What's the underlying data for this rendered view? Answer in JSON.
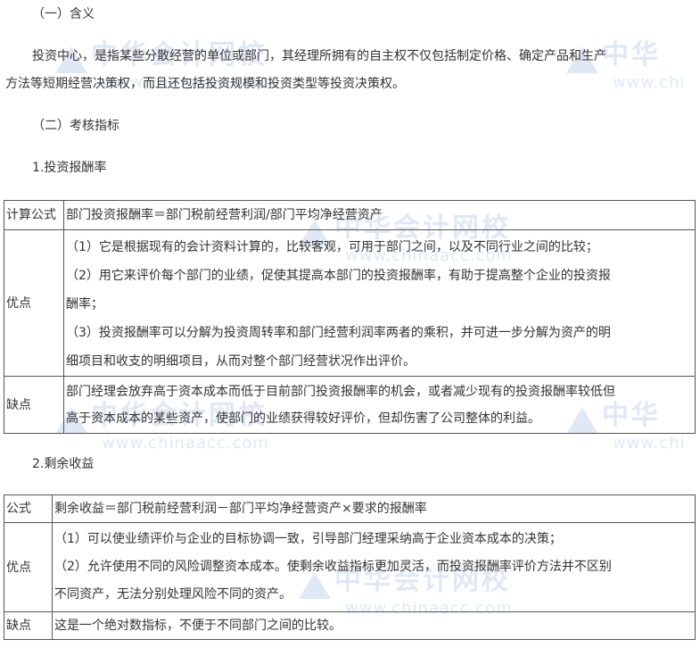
{
  "section1": {
    "heading": "（一）含义",
    "para_line1": "投资中心，是指某些分散经营的单位或部门，其经理所拥有的自主权不仅包括制定价格、确定产品和生产",
    "para_line2": "方法等短期经营决策权，而且还包括投资规模和投资类型等投资决策权。"
  },
  "section2": {
    "heading": "（二）考核指标",
    "sub1": "1.投资报酬率",
    "sub2": "2.剩余收益"
  },
  "table1": {
    "formula_label": "计算公式",
    "formula": "部门投资报酬率＝部门税前经营利润/部门平均净经营资产",
    "adv_label": "优点",
    "adv_lines": [
      "（1）它是根据现有的会计资料计算的，比较客观，可用于部门之间，以及不同行业之间的比较；",
      "（2）用它来评价每个部门的业绩，促使其提高本部门的投资报酬率，有助于提高整个企业的投资报",
      "酬率；",
      "（3）投资报酬率可以分解为投资周转率和部门经营利润率两者的乘积，并可进一步分解为资产的明",
      "细项目和收支的明细项目，从而对整个部门经营状况作出评价。"
    ],
    "dis_label": "缺点",
    "dis_lines": [
      "部门经理会放弃高于资本成本而低于目前部门投资报酬率的机会，或者减少现有的投资报酬率较低但",
      "高于资本成本的某些资产，使部门的业绩获得较好评价，但却伤害了公司整体的利益。"
    ]
  },
  "table2": {
    "formula_label": "公式",
    "formula": "剩余收益＝部门税前经营利润－部门平均净经营资产×要求的报酬率",
    "adv_label": "优点",
    "adv_lines": [
      "（1）可以使业绩评价与企业的目标协调一致，引导部门经理采纳高于企业资本成本的决策；",
      "（2）允许使用不同的风险调整资本成本。使剩余收益指标更加灵活，而投资报酬率评价方法并不区别",
      "不同资产，无法分别处理风险不同的资产。"
    ],
    "dis_label": "缺点",
    "dis_text": "这是一个绝对数指标，不便于不同部门之间的比较。"
  },
  "watermark": {
    "cn": "中华会计网校",
    "cn_short": "中华",
    "en": "www.chinaacc.com",
    "en_short": "www.chi",
    "icon": "chinaacc-logo-icon"
  }
}
